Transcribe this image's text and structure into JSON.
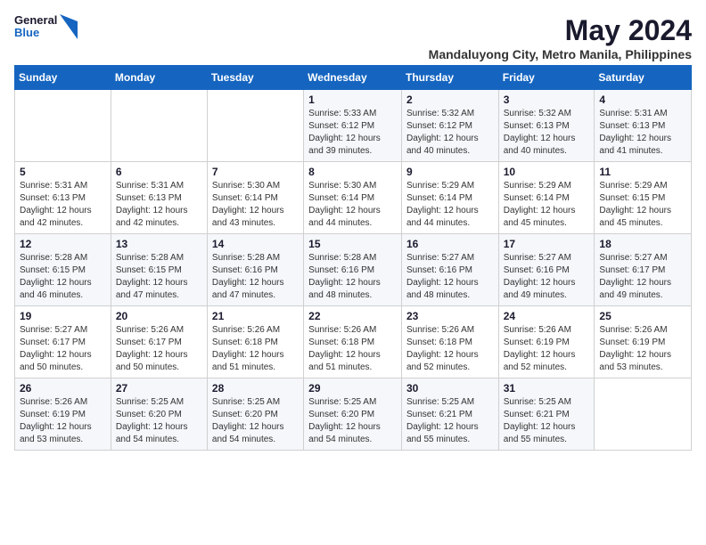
{
  "logo": {
    "general": "General",
    "blue": "Blue"
  },
  "title": "May 2024",
  "subtitle": "Mandaluyong City, Metro Manila, Philippines",
  "days_of_week": [
    "Sunday",
    "Monday",
    "Tuesday",
    "Wednesday",
    "Thursday",
    "Friday",
    "Saturday"
  ],
  "weeks": [
    [
      {
        "day": "",
        "info": ""
      },
      {
        "day": "",
        "info": ""
      },
      {
        "day": "",
        "info": ""
      },
      {
        "day": "1",
        "info": "Sunrise: 5:33 AM\nSunset: 6:12 PM\nDaylight: 12 hours\nand 39 minutes."
      },
      {
        "day": "2",
        "info": "Sunrise: 5:32 AM\nSunset: 6:12 PM\nDaylight: 12 hours\nand 40 minutes."
      },
      {
        "day": "3",
        "info": "Sunrise: 5:32 AM\nSunset: 6:13 PM\nDaylight: 12 hours\nand 40 minutes."
      },
      {
        "day": "4",
        "info": "Sunrise: 5:31 AM\nSunset: 6:13 PM\nDaylight: 12 hours\nand 41 minutes."
      }
    ],
    [
      {
        "day": "5",
        "info": "Sunrise: 5:31 AM\nSunset: 6:13 PM\nDaylight: 12 hours\nand 42 minutes."
      },
      {
        "day": "6",
        "info": "Sunrise: 5:31 AM\nSunset: 6:13 PM\nDaylight: 12 hours\nand 42 minutes."
      },
      {
        "day": "7",
        "info": "Sunrise: 5:30 AM\nSunset: 6:14 PM\nDaylight: 12 hours\nand 43 minutes."
      },
      {
        "day": "8",
        "info": "Sunrise: 5:30 AM\nSunset: 6:14 PM\nDaylight: 12 hours\nand 44 minutes."
      },
      {
        "day": "9",
        "info": "Sunrise: 5:29 AM\nSunset: 6:14 PM\nDaylight: 12 hours\nand 44 minutes."
      },
      {
        "day": "10",
        "info": "Sunrise: 5:29 AM\nSunset: 6:14 PM\nDaylight: 12 hours\nand 45 minutes."
      },
      {
        "day": "11",
        "info": "Sunrise: 5:29 AM\nSunset: 6:15 PM\nDaylight: 12 hours\nand 45 minutes."
      }
    ],
    [
      {
        "day": "12",
        "info": "Sunrise: 5:28 AM\nSunset: 6:15 PM\nDaylight: 12 hours\nand 46 minutes."
      },
      {
        "day": "13",
        "info": "Sunrise: 5:28 AM\nSunset: 6:15 PM\nDaylight: 12 hours\nand 47 minutes."
      },
      {
        "day": "14",
        "info": "Sunrise: 5:28 AM\nSunset: 6:16 PM\nDaylight: 12 hours\nand 47 minutes."
      },
      {
        "day": "15",
        "info": "Sunrise: 5:28 AM\nSunset: 6:16 PM\nDaylight: 12 hours\nand 48 minutes."
      },
      {
        "day": "16",
        "info": "Sunrise: 5:27 AM\nSunset: 6:16 PM\nDaylight: 12 hours\nand 48 minutes."
      },
      {
        "day": "17",
        "info": "Sunrise: 5:27 AM\nSunset: 6:16 PM\nDaylight: 12 hours\nand 49 minutes."
      },
      {
        "day": "18",
        "info": "Sunrise: 5:27 AM\nSunset: 6:17 PM\nDaylight: 12 hours\nand 49 minutes."
      }
    ],
    [
      {
        "day": "19",
        "info": "Sunrise: 5:27 AM\nSunset: 6:17 PM\nDaylight: 12 hours\nand 50 minutes."
      },
      {
        "day": "20",
        "info": "Sunrise: 5:26 AM\nSunset: 6:17 PM\nDaylight: 12 hours\nand 50 minutes."
      },
      {
        "day": "21",
        "info": "Sunrise: 5:26 AM\nSunset: 6:18 PM\nDaylight: 12 hours\nand 51 minutes."
      },
      {
        "day": "22",
        "info": "Sunrise: 5:26 AM\nSunset: 6:18 PM\nDaylight: 12 hours\nand 51 minutes."
      },
      {
        "day": "23",
        "info": "Sunrise: 5:26 AM\nSunset: 6:18 PM\nDaylight: 12 hours\nand 52 minutes."
      },
      {
        "day": "24",
        "info": "Sunrise: 5:26 AM\nSunset: 6:19 PM\nDaylight: 12 hours\nand 52 minutes."
      },
      {
        "day": "25",
        "info": "Sunrise: 5:26 AM\nSunset: 6:19 PM\nDaylight: 12 hours\nand 53 minutes."
      }
    ],
    [
      {
        "day": "26",
        "info": "Sunrise: 5:26 AM\nSunset: 6:19 PM\nDaylight: 12 hours\nand 53 minutes."
      },
      {
        "day": "27",
        "info": "Sunrise: 5:25 AM\nSunset: 6:20 PM\nDaylight: 12 hours\nand 54 minutes."
      },
      {
        "day": "28",
        "info": "Sunrise: 5:25 AM\nSunset: 6:20 PM\nDaylight: 12 hours\nand 54 minutes."
      },
      {
        "day": "29",
        "info": "Sunrise: 5:25 AM\nSunset: 6:20 PM\nDaylight: 12 hours\nand 54 minutes."
      },
      {
        "day": "30",
        "info": "Sunrise: 5:25 AM\nSunset: 6:21 PM\nDaylight: 12 hours\nand 55 minutes."
      },
      {
        "day": "31",
        "info": "Sunrise: 5:25 AM\nSunset: 6:21 PM\nDaylight: 12 hours\nand 55 minutes."
      },
      {
        "day": "",
        "info": ""
      }
    ]
  ]
}
